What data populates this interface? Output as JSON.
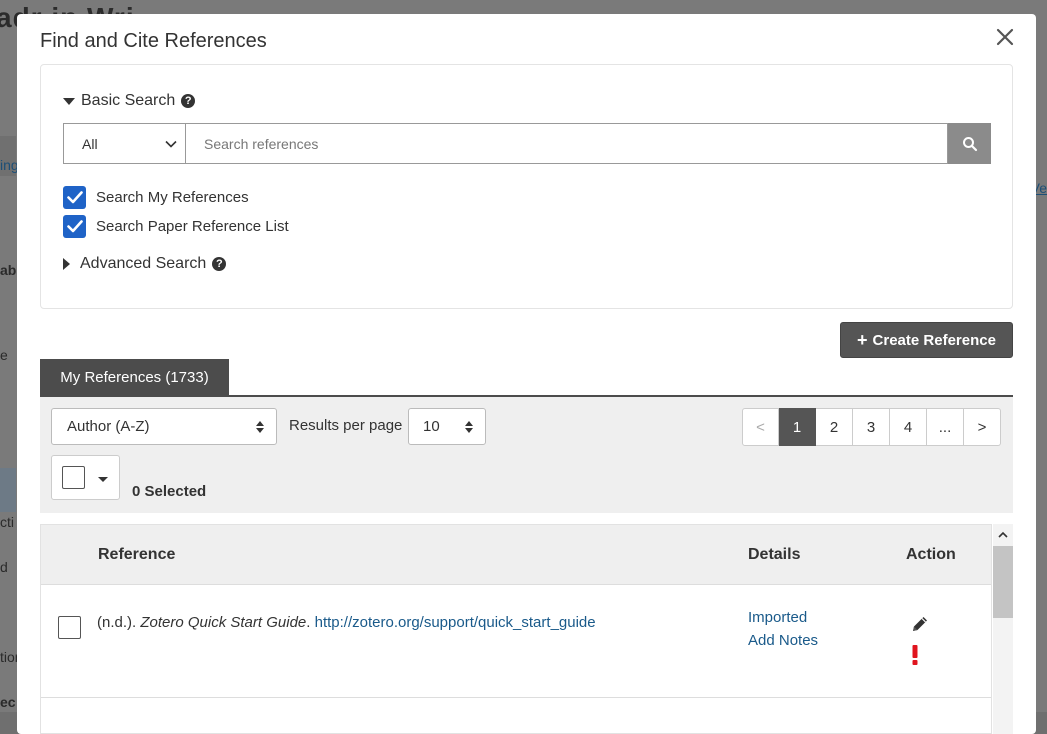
{
  "background": {
    "title_fragment": "adr in Wri",
    "left_fragments": [
      "ing",
      "ab",
      "e",
      "cti",
      "d",
      "tion",
      "ec"
    ],
    "right_fragment": "Ve"
  },
  "modal": {
    "title": "Find and Cite References",
    "close_icon": "close-icon"
  },
  "basic_search": {
    "label": "Basic Search",
    "help": "?",
    "scope_value": "All",
    "placeholder": "Search references",
    "value": "",
    "options": [
      {
        "label": "Search My References",
        "checked": true
      },
      {
        "label": "Search Paper Reference List",
        "checked": true
      }
    ]
  },
  "advanced_search": {
    "label": "Advanced Search",
    "help": "?"
  },
  "create_reference": {
    "icon": "+",
    "label": "Create Reference"
  },
  "tabs": [
    {
      "label": "My References (1733)",
      "active": true
    }
  ],
  "toolbar": {
    "sort_value": "Author (A-Z)",
    "results_per_page_label": "Results per page",
    "results_per_page_value": "10",
    "pagination": [
      "<",
      "1",
      "2",
      "3",
      "4",
      "...",
      ">"
    ],
    "current_page": "1",
    "selected_count": "0 Selected"
  },
  "table": {
    "headers": {
      "reference": "Reference",
      "details": "Details",
      "action": "Action"
    },
    "rows": [
      {
        "prefix": "(n.d.). ",
        "title": "Zotero Quick Start Guide",
        "sep": ". ",
        "link": "http://zotero.org/support/quick_start_guide",
        "details": [
          "Imported",
          "Add Notes"
        ],
        "warning": "!"
      }
    ]
  },
  "colors": {
    "accent_blue": "#1f63c7",
    "link": "#1a5a8a",
    "dark_button": "#555555",
    "warning": "#e0141e"
  }
}
